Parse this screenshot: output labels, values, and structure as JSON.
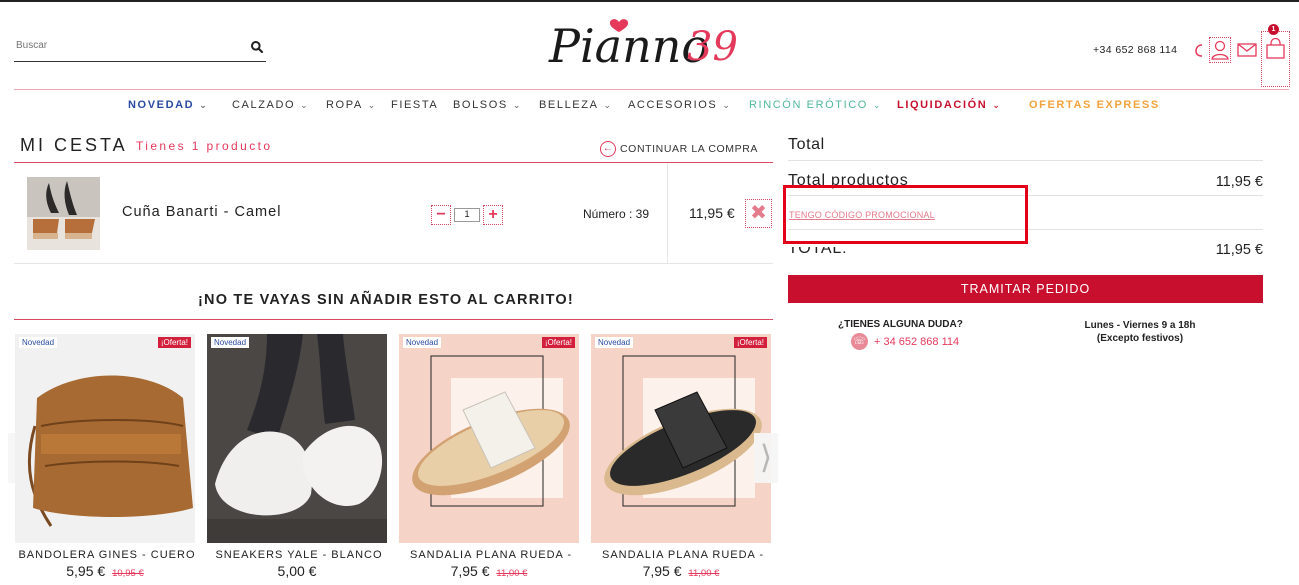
{
  "header": {
    "search_placeholder": "Buscar",
    "logo_text": "Pianno",
    "logo_number": "39",
    "phone": "+34 652 868 114",
    "cart_count": "1"
  },
  "nav": [
    {
      "label": "NOVEDAD",
      "chevron": "⌄",
      "color": "#2a4aa2",
      "bold": true
    },
    {
      "label": "CALZADO",
      "chevron": "⌄",
      "color": "#333333",
      "bold": false
    },
    {
      "label": "ROPA",
      "chevron": "⌄",
      "color": "#333333",
      "bold": false
    },
    {
      "label": "FIESTA",
      "chevron": "",
      "color": "#333333",
      "bold": false
    },
    {
      "label": "BOLSOS",
      "chevron": "⌄",
      "color": "#333333",
      "bold": false
    },
    {
      "label": "BELLEZA",
      "chevron": "⌄",
      "color": "#333333",
      "bold": false
    },
    {
      "label": "ACCESORIOS",
      "chevron": "⌄",
      "color": "#333333",
      "bold": false
    },
    {
      "label": "RINCÓN ERÓTICO",
      "chevron": "⌄",
      "color": "#4fb79a",
      "bold": false
    },
    {
      "label": "LIQUIDACIÓN",
      "chevron": "⌄",
      "color": "#c8102e",
      "bold": true
    },
    {
      "label": "OFERTAS EXPRESS",
      "chevron": "",
      "color": "#f2a23c",
      "bold": true
    }
  ],
  "basket": {
    "title": "MI CESTA",
    "count_text": "Tienes 1 producto",
    "continue_label": "CONTINUAR LA COMPRA",
    "item": {
      "name": "Cuña Banarti - Camel",
      "quantity": "1",
      "size": "Número : 39",
      "price": "11,95 €"
    }
  },
  "upsell": {
    "title": "¡NO TE VAYAS SIN AÑADIR ESTO AL CARRITO!",
    "products": [
      {
        "name": "BANDOLERA GINES - CUERO",
        "price": "5,95 €",
        "old_price": "10,95 €",
        "tag_new": "Novedad",
        "tag_offer": "¡Oferta!"
      },
      {
        "name": "SNEAKERS YALE - BLANCO",
        "price": "5,00 €",
        "old_price": "",
        "tag_new": "Novedad",
        "tag_offer": ""
      },
      {
        "name": "SANDALIA PLANA RUEDA -",
        "price": "7,95 €",
        "old_price": "11,00 €",
        "tag_new": "Novedad",
        "tag_offer": "¡Oferta!"
      },
      {
        "name": "SANDALIA PLANA RUEDA -",
        "price": "7,95 €",
        "old_price": "11,00 €",
        "tag_new": "Novedad",
        "tag_offer": "¡Oferta!"
      }
    ]
  },
  "summary": {
    "title": "Total",
    "products_label": "Total productos",
    "products_value": "11,95 €",
    "promo_link": "TENGO CÓDIGO PROMOCIONAL",
    "total_label": "TOTAL:",
    "total_value": "11,95 €",
    "cta": "TRAMITAR PEDIDO",
    "help_question": "¿TIENES ALGUNA DUDA?",
    "help_phone": "+ 34 652 868 114",
    "hours_line1": "Lunes - Viernes 9 a 18h",
    "hours_line2": "(Excepto festivos)"
  },
  "colors": {
    "brand": "#c8102e",
    "accent_pink": "#e5395b",
    "nav_blue": "#2a4aa2"
  }
}
